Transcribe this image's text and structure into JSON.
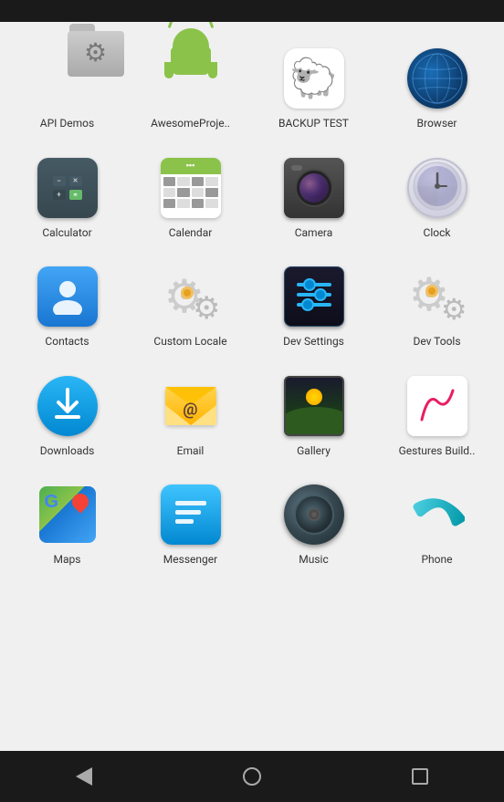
{
  "statusBar": {
    "color": "#1a1a1a"
  },
  "navBar": {
    "back": "◁",
    "home": "○",
    "recents": "□"
  },
  "apps": [
    {
      "id": "api-demos",
      "label": "API Demos",
      "iconType": "api-demos"
    },
    {
      "id": "awesome-project",
      "label": "AwesomeProje..",
      "iconType": "android"
    },
    {
      "id": "backup-test",
      "label": "BACKUP TEST",
      "iconType": "backup",
      "emoji": "🐑"
    },
    {
      "id": "browser",
      "label": "Browser",
      "iconType": "browser"
    },
    {
      "id": "calculator",
      "label": "Calculator",
      "iconType": "calculator"
    },
    {
      "id": "calendar",
      "label": "Calendar",
      "iconType": "calendar"
    },
    {
      "id": "camera",
      "label": "Camera",
      "iconType": "camera"
    },
    {
      "id": "clock",
      "label": "Clock",
      "iconType": "clock"
    },
    {
      "id": "contacts",
      "label": "Contacts",
      "iconType": "contacts"
    },
    {
      "id": "custom-locale",
      "label": "Custom Locale",
      "iconType": "custom-locale"
    },
    {
      "id": "dev-settings",
      "label": "Dev Settings",
      "iconType": "dev-settings"
    },
    {
      "id": "dev-tools",
      "label": "Dev Tools",
      "iconType": "dev-tools"
    },
    {
      "id": "downloads",
      "label": "Downloads",
      "iconType": "downloads"
    },
    {
      "id": "email",
      "label": "Email",
      "iconType": "email"
    },
    {
      "id": "gallery",
      "label": "Gallery",
      "iconType": "gallery"
    },
    {
      "id": "gestures-builder",
      "label": "Gestures Build..",
      "iconType": "gestures"
    },
    {
      "id": "maps",
      "label": "Maps",
      "iconType": "maps"
    },
    {
      "id": "messenger",
      "label": "Messenger",
      "iconType": "messenger"
    },
    {
      "id": "music",
      "label": "Music",
      "iconType": "music"
    },
    {
      "id": "phone",
      "label": "Phone",
      "iconType": "phone"
    }
  ]
}
